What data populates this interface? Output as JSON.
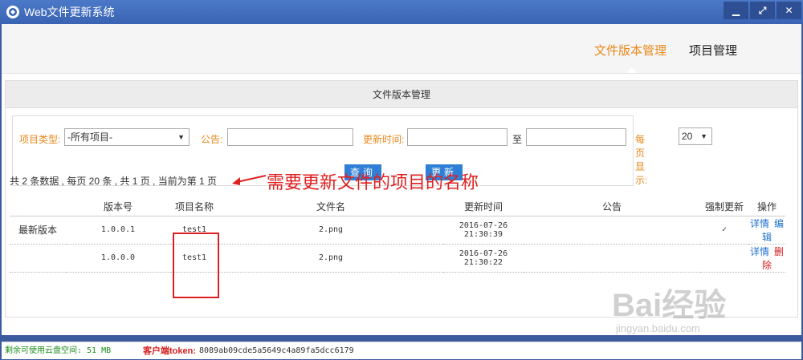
{
  "window": {
    "title": "Web文件更新系统",
    "buttons": [
      "minimize-icon",
      "maximize-icon",
      "close-icon"
    ]
  },
  "nav": {
    "items": [
      {
        "label": "文件版本管理",
        "active": true
      },
      {
        "label": "项目管理",
        "active": false
      }
    ]
  },
  "panel": {
    "header": "文件版本管理"
  },
  "filters": {
    "project_type_label": "项目类型:",
    "project_type_value": "-所有项目-",
    "notice_label": "公告:",
    "notice_value": "",
    "update_time_label": "更新时间:",
    "time_from": "",
    "to_label": "至",
    "time_to": "",
    "per_page_label": "每页显示:",
    "per_page_value": "20",
    "query_button": "查询",
    "update_button": "更新"
  },
  "summary": "共 2 条数据 , 每页 20 条 , 共 1 页 , 当前为第 1 页",
  "callout": "需要更新文件的项目的名称",
  "table": {
    "headers": [
      "",
      "版本号",
      "项目名称",
      "文件名",
      "更新时间",
      "公告",
      "强制更新",
      "操作"
    ],
    "rows": [
      {
        "tag": "最新版本",
        "version": "1.0.0.1",
        "project": "test1",
        "file": "2.png",
        "time": "2016-07-26 21:30:39",
        "notice": "",
        "force": "✓",
        "actions": [
          "详情",
          "编辑"
        ]
      },
      {
        "tag": "",
        "version": "1.0.0.0",
        "project": "test1",
        "file": "2.png",
        "time": "2016-07-26 21:30:22",
        "notice": "",
        "force": "",
        "actions": [
          "详情",
          "删除"
        ]
      }
    ]
  },
  "status": {
    "storage": "剩余可使用云盘空间: 51 MB",
    "token_label": "客户端token:",
    "token_value": "8089ab09cde5a5649c4a89fa5dcc6179"
  },
  "watermark": {
    "brand": "Bai经验",
    "url": "jingyan.baidu.com"
  },
  "colors": {
    "accent": "#e8891c",
    "button_blue": "#2f7fd6",
    "title_bar": "#3a64b3",
    "callout_red": "#e02020"
  }
}
